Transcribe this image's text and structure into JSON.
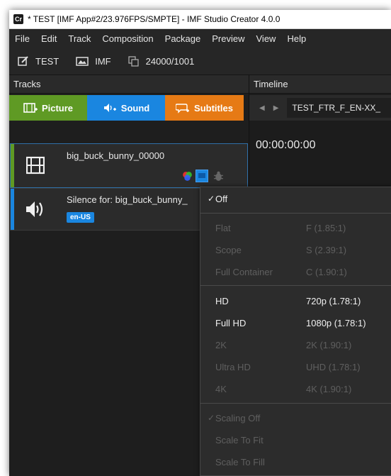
{
  "window": {
    "title": "* TEST [IMF App#2/23.976FPS/SMPTE] - IMF Studio Creator 4.0.0",
    "app_icon_text": "Cr"
  },
  "menu": [
    "File",
    "Edit",
    "Track",
    "Composition",
    "Package",
    "Preview",
    "View",
    "Help"
  ],
  "toolbar": {
    "project_name": "TEST",
    "package_type": "IMF",
    "edit_rate": "24000/1001"
  },
  "tracks_panel": {
    "title": "Tracks",
    "tabs": [
      {
        "label": "Picture",
        "color": "#5f9a24"
      },
      {
        "label": "Sound",
        "color": "#1a86e0"
      },
      {
        "label": "Subtitles",
        "color": "#e67a15"
      }
    ],
    "tracks": [
      {
        "label": "big_buck_bunny_00000",
        "type": "picture",
        "bar_color": "#5f9a24"
      },
      {
        "label": "Silence for: big_buck_bunny_",
        "type": "sound",
        "bar_color": "#1a86e0",
        "language": "en-US"
      }
    ]
  },
  "timeline_panel": {
    "title": "Timeline",
    "composition_name": "TEST_FTR_F_EN-XX_",
    "timecode": "00:00:00:00"
  },
  "aspect_menu": {
    "groups": [
      [
        {
          "checked": true,
          "label": "Off",
          "value": "",
          "enabled": true
        }
      ],
      [
        {
          "checked": false,
          "label": "Flat",
          "value": "F (1.85:1)",
          "enabled": false
        },
        {
          "checked": false,
          "label": "Scope",
          "value": "S (2.39:1)",
          "enabled": false
        },
        {
          "checked": false,
          "label": "Full Container",
          "value": "C (1.90:1)",
          "enabled": false
        }
      ],
      [
        {
          "checked": false,
          "label": "HD",
          "value": "720p (1.78:1)",
          "enabled": true
        },
        {
          "checked": false,
          "label": "Full HD",
          "value": "1080p (1.78:1)",
          "enabled": true
        },
        {
          "checked": false,
          "label": "2K",
          "value": "2K (1.90:1)",
          "enabled": false
        },
        {
          "checked": false,
          "label": "Ultra HD",
          "value": "UHD (1.78:1)",
          "enabled": false
        },
        {
          "checked": false,
          "label": "4K",
          "value": "4K (1.90:1)",
          "enabled": false
        }
      ],
      [
        {
          "checked": true,
          "label": "Scaling Off",
          "value": "",
          "enabled": false
        },
        {
          "checked": false,
          "label": "Scale To Fit",
          "value": "",
          "enabled": false
        },
        {
          "checked": false,
          "label": "Scale To Fill",
          "value": "",
          "enabled": false
        }
      ]
    ]
  }
}
